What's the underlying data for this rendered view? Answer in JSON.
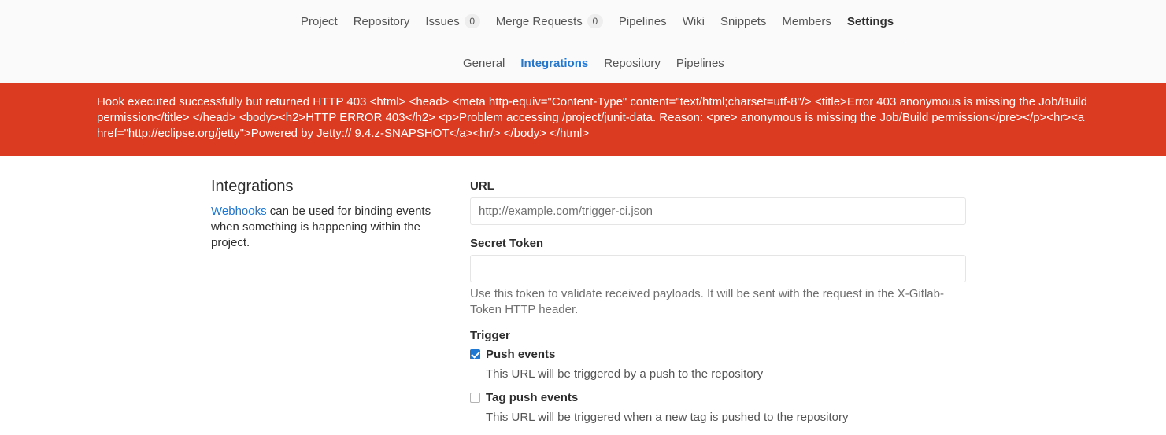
{
  "top_nav": {
    "items": [
      {
        "label": "Project"
      },
      {
        "label": "Repository"
      },
      {
        "label": "Issues",
        "count": "0"
      },
      {
        "label": "Merge Requests",
        "count": "0"
      },
      {
        "label": "Pipelines"
      },
      {
        "label": "Wiki"
      },
      {
        "label": "Snippets"
      },
      {
        "label": "Members"
      },
      {
        "label": "Settings"
      }
    ],
    "active": "Settings",
    "accent_color": "#1f78d1"
  },
  "sub_nav": {
    "items": [
      {
        "label": "General"
      },
      {
        "label": "Integrations"
      },
      {
        "label": "Repository"
      },
      {
        "label": "Pipelines"
      }
    ],
    "active": "Integrations"
  },
  "flash": {
    "message": "Hook executed successfully but returned HTTP 403 <html> <head> <meta http-equiv=\"Content-Type\" content=\"text/html;charset=utf-8\"/> <title>Error 403 anonymous is missing the Job/Build permission</title> </head> <body><h2>HTTP ERROR 403</h2> <p>Problem accessing /project/junit-data. Reason: <pre> anonymous is missing the Job/Build permission</pre></p><hr><a href=\"http://eclipse.org/jetty\">Powered by Jetty:// 9.4.z-SNAPSHOT</a><hr/> </body> </html>",
    "color": "#db3b21"
  },
  "integrations": {
    "title": "Integrations",
    "webhooks_link": "Webhooks",
    "description": "can be used for binding events when something is happening within the project."
  },
  "form": {
    "url_label": "URL",
    "url_placeholder": "http://example.com/trigger-ci.json",
    "url_value": "",
    "secret_label": "Secret Token",
    "secret_value": "",
    "secret_help": "Use this token to validate received payloads. It will be sent with the request in the X-Gitlab-Token HTTP header.",
    "trigger_label": "Trigger",
    "triggers": [
      {
        "title": "Push events",
        "description": "This URL will be triggered by a push to the repository",
        "checked": true
      },
      {
        "title": "Tag push events",
        "description": "This URL will be triggered when a new tag is pushed to the repository",
        "checked": false
      }
    ]
  }
}
